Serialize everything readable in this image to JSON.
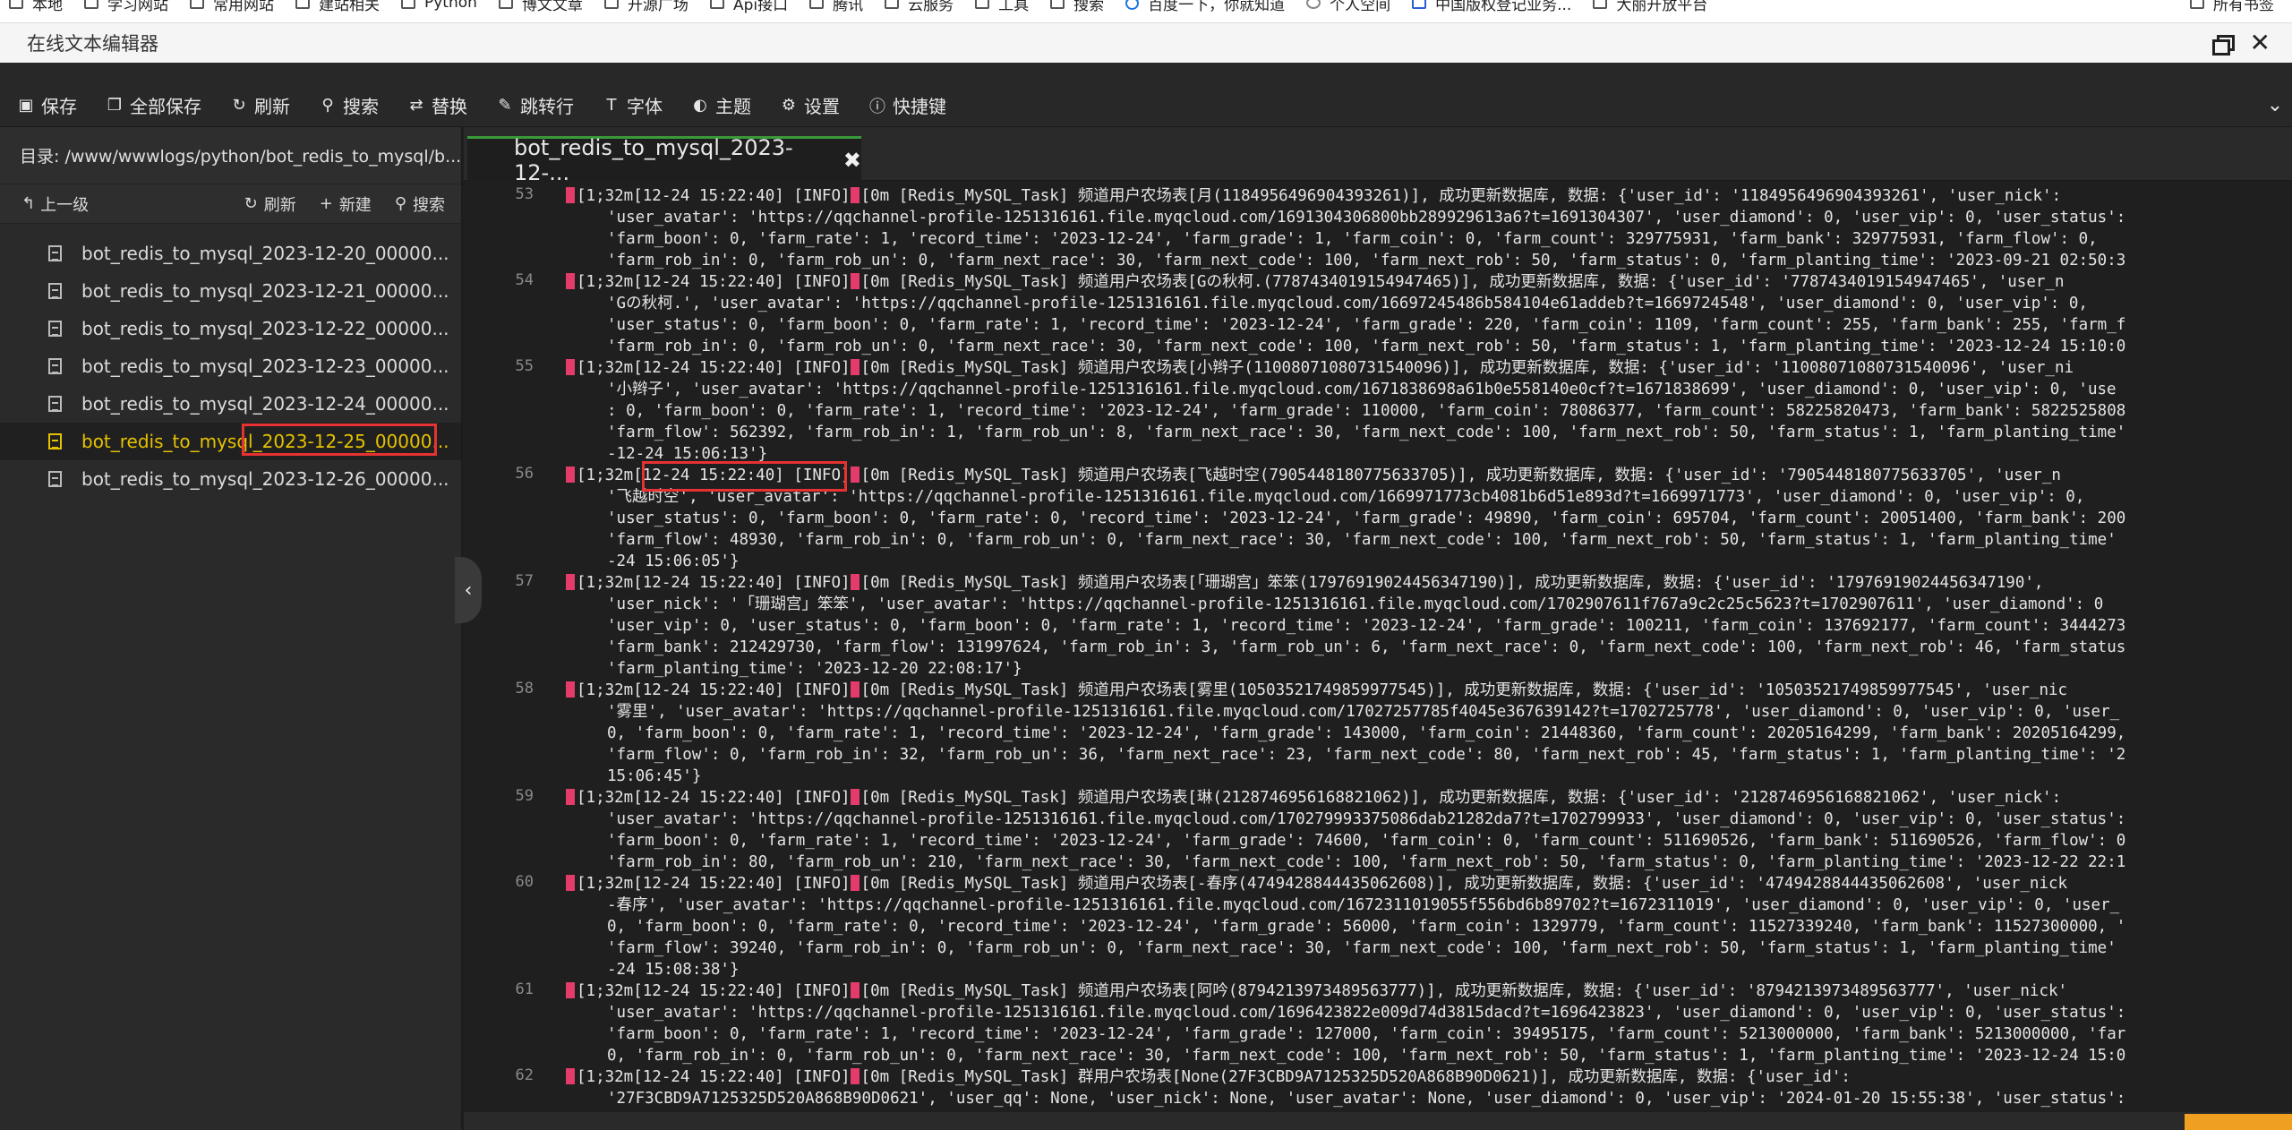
{
  "bookmarks": [
    "本地",
    "学习网站",
    "常用网站",
    "建站相关",
    "Python",
    "博文文章",
    "开源广场",
    "Api接口",
    "腾讯",
    "云服务",
    "工具",
    "搜索",
    "百度一下，你就知道",
    "个人空间",
    "中国版权登记业务...",
    "大丽开放平台"
  ],
  "bookmarks_right": "所有书签",
  "window": {
    "title": "在线文本编辑器"
  },
  "toolbar": {
    "save": "保存",
    "save_all": "全部保存",
    "refresh": "刷新",
    "search": "搜索",
    "replace": "替换",
    "goto_line": "跳转行",
    "font": "字体",
    "theme": "主题",
    "settings": "设置",
    "shortcuts": "快捷键"
  },
  "sidebar": {
    "dir_path": "目录: /www/wwwlogs/python/bot_redis_to_mysql/b...",
    "up_label": "上一级",
    "refresh_label": "刷新",
    "new_label": "新建",
    "search_label": "搜索",
    "files": [
      "bot_redis_to_mysql_2023-12-20_00000...",
      "bot_redis_to_mysql_2023-12-21_00000...",
      "bot_redis_to_mysql_2023-12-22_00000...",
      "bot_redis_to_mysql_2023-12-23_00000...",
      "bot_redis_to_mysql_2023-12-24_00000...",
      "bot_redis_to_mysql_2023-12-25_00000...",
      "bot_redis_to_mysql_2023-12-26_00000..."
    ],
    "active_index": 5
  },
  "editor": {
    "tab_title": "bot_redis_to_mysql_2023-12-...",
    "lines": [
      {
        "n": "53",
        "rows": [
          "[1;32m[12-24 15:22:40] [INFO]|[0m [Redis_MySQL_Task] 频道用户农场表[月(1184956496904393261)], 成功更新数据库, 数据: {'user_id': '1184956496904393261', 'user_nick':",
          "'user_avatar': 'https://qqchannel-profile-1251316161.file.myqcloud.com/1691304306800bb289929613a6?t=1691304307', 'user_diamond': 0, 'user_vip': 0, 'user_status':",
          "'farm_boon': 0, 'farm_rate': 1, 'record_time': '2023-12-24', 'farm_grade': 1, 'farm_coin': 0, 'farm_count': 329775931, 'farm_bank': 329775931, 'farm_flow': 0,",
          "'farm_rob_in': 0, 'farm_rob_un': 0, 'farm_next_race': 30, 'farm_next_code': 100, 'farm_next_rob': 50, 'farm_status': 0, 'farm_planting_time': '2023-09-21 02:50:3"
        ]
      },
      {
        "n": "54",
        "rows": [
          "[1;32m[12-24 15:22:40] [INFO]|[0m [Redis_MySQL_Task] 频道用户农场表[Gの秋柯.(7787434019154947465)], 成功更新数据库, 数据: {'user_id': '7787434019154947465', 'user_n",
          "'Gの秋柯.', 'user_avatar': 'https://qqchannel-profile-1251316161.file.myqcloud.com/16697245486b584104e61addeb?t=1669724548', 'user_diamond': 0, 'user_vip': 0,",
          "'user_status': 0, 'farm_boon': 0, 'farm_rate': 1, 'record_time': '2023-12-24', 'farm_grade': 220, 'farm_coin': 1109, 'farm_count': 255, 'farm_bank': 255, 'farm_f",
          "'farm_rob_in': 0, 'farm_rob_un': 0, 'farm_next_race': 30, 'farm_next_code': 100, 'farm_next_rob': 50, 'farm_status': 1, 'farm_planting_time': '2023-12-24 15:10:0"
        ]
      },
      {
        "n": "55",
        "rows": [
          "[1;32m[12-24 15:22:40] [INFO]|[0m [Redis_MySQL_Task] 频道用户农场表[小辫子(11008071080731540096)], 成功更新数据库, 数据: {'user_id': '11008071080731540096', 'user_ni",
          "'小辫子', 'user_avatar': 'https://qqchannel-profile-1251316161.file.myqcloud.com/1671838698a61b0e558140e0cf?t=1671838699', 'user_diamond': 0, 'user_vip': 0, 'use",
          ": 0, 'farm_boon': 0, 'farm_rate': 1, 'record_time': '2023-12-24', 'farm_grade': 110000, 'farm_coin': 78086377, 'farm_count': 58225820473, 'farm_bank': 5822525808",
          "'farm_flow': 562392, 'farm_rob_in': 1, 'farm_rob_un': 8, 'farm_next_race': 30, 'farm_next_code': 100, 'farm_next_rob': 50, 'farm_status': 1, 'farm_planting_time'",
          "-12-24 15:06:13'}"
        ]
      },
      {
        "n": "56",
        "rows": [
          "[1;32m[12-24 15:22:40] [INFO]|[0m [Redis_MySQL_Task] 频道用户农场表[飞越时空(7905448180775633705)], 成功更新数据库, 数据: {'user_id': '7905448180775633705', 'user_n",
          "'飞越时空', 'user_avatar': 'https://qqchannel-profile-1251316161.file.myqcloud.com/1669971773cb4081b6d51e893d?t=1669971773', 'user_diamond': 0, 'user_vip': 0,",
          "'user_status': 0, 'farm_boon': 0, 'farm_rate': 0, 'record_time': '2023-12-24', 'farm_grade': 49890, 'farm_coin': 695704, 'farm_count': 20051400, 'farm_bank': 200",
          "'farm_flow': 48930, 'farm_rob_in': 0, 'farm_rob_un': 0, 'farm_next_race': 30, 'farm_next_code': 100, 'farm_next_rob': 50, 'farm_status': 1, 'farm_planting_time'",
          "-24 15:06:05'}"
        ]
      },
      {
        "n": "57",
        "rows": [
          "[1;32m[12-24 15:22:40] [INFO]|[0m [Redis_MySQL_Task] 频道用户农场表[「珊瑚宫」笨笨(17976919024456347190)], 成功更新数据库, 数据: {'user_id': '17976919024456347190',",
          "'user_nick': '「珊瑚宫」笨笨', 'user_avatar': 'https://qqchannel-profile-1251316161.file.myqcloud.com/1702907611f767a9c2c25c5623?t=1702907611', 'user_diamond': 0",
          "'user_vip': 0, 'user_status': 0, 'farm_boon': 0, 'farm_rate': 1, 'record_time': '2023-12-24', 'farm_grade': 100211, 'farm_coin': 137692177, 'farm_count': 3444273",
          "'farm_bank': 212429730, 'farm_flow': 131997624, 'farm_rob_in': 3, 'farm_rob_un': 6, 'farm_next_race': 0, 'farm_next_code': 100, 'farm_next_rob': 46, 'farm_status",
          "'farm_planting_time': '2023-12-20 22:08:17'}"
        ]
      },
      {
        "n": "58",
        "rows": [
          "[1;32m[12-24 15:22:40] [INFO]|[0m [Redis_MySQL_Task] 频道用户农场表[雾里(10503521749859977545)], 成功更新数据库, 数据: {'user_id': '10503521749859977545', 'user_nic",
          "'雾里', 'user_avatar': 'https://qqchannel-profile-1251316161.file.myqcloud.com/17027257785f4045e367639142?t=1702725778', 'user_diamond': 0, 'user_vip': 0, 'user_",
          "0, 'farm_boon': 0, 'farm_rate': 1, 'record_time': '2023-12-24', 'farm_grade': 143000, 'farm_coin': 21448360, 'farm_count': 20205164299, 'farm_bank': 20205164299,",
          "'farm_flow': 0, 'farm_rob_in': 32, 'farm_rob_un': 36, 'farm_next_race': 23, 'farm_next_code': 80, 'farm_next_rob': 45, 'farm_status': 1, 'farm_planting_time': '2",
          "15:06:45'}"
        ]
      },
      {
        "n": "59",
        "rows": [
          "[1;32m[12-24 15:22:40] [INFO]|[0m [Redis_MySQL_Task] 频道用户农场表[琳(2128746956168821062)], 成功更新数据库, 数据: {'user_id': '2128746956168821062', 'user_nick':",
          "'user_avatar': 'https://qqchannel-profile-1251316161.file.myqcloud.com/170279993375086dab21282da7?t=1702799933', 'user_diamond': 0, 'user_vip': 0, 'user_status':",
          "'farm_boon': 0, 'farm_rate': 1, 'record_time': '2023-12-24', 'farm_grade': 74600, 'farm_coin': 0, 'farm_count': 511690526, 'farm_bank': 511690526, 'farm_flow': 0",
          "'farm_rob_in': 80, 'farm_rob_un': 210, 'farm_next_race': 30, 'farm_next_code': 100, 'farm_next_rob': 50, 'farm_status': 0, 'farm_planting_time': '2023-12-22 22:1"
        ]
      },
      {
        "n": "60",
        "rows": [
          "[1;32m[12-24 15:22:40] [INFO]|[0m [Redis_MySQL_Task] 频道用户农场表[-春序(4749428844435062608)], 成功更新数据库, 数据: {'user_id': '4749428844435062608', 'user_nick",
          "-春序', 'user_avatar': 'https://qqchannel-profile-1251316161.file.myqcloud.com/1672311019055f556bd6b89702?t=1672311019', 'user_diamond': 0, 'user_vip': 0, 'user_",
          "0, 'farm_boon': 0, 'farm_rate': 0, 'record_time': '2023-12-24', 'farm_grade': 56000, 'farm_coin': 1329779, 'farm_count': 11527339240, 'farm_bank': 11527300000, '",
          "'farm_flow': 39240, 'farm_rob_in': 0, 'farm_rob_un': 0, 'farm_next_race': 30, 'farm_next_code': 100, 'farm_next_rob': 50, 'farm_status': 1, 'farm_planting_time'",
          "-24 15:08:38'}"
        ]
      },
      {
        "n": "61",
        "rows": [
          "[1;32m[12-24 15:22:40] [INFO]|[0m [Redis_MySQL_Task] 频道用户农场表[阿吟(8794213973489563777)], 成功更新数据库, 数据: {'user_id': '8794213973489563777', 'user_nick'",
          "'user_avatar': 'https://qqchannel-profile-1251316161.file.myqcloud.com/1696423822e009d74d3815dacd?t=1696423823', 'user_diamond': 0, 'user_vip': 0, 'user_status':",
          "'farm_boon': 0, 'farm_rate': 1, 'record_time': '2023-12-24', 'farm_grade': 127000, 'farm_coin': 39495175, 'farm_count': 5213000000, 'farm_bank': 5213000000, 'far",
          "0, 'farm_rob_in': 0, 'farm_rob_un': 0, 'farm_next_race': 30, 'farm_next_code': 100, 'farm_next_rob': 50, 'farm_status': 1, 'farm_planting_time': '2023-12-24 15:0"
        ]
      },
      {
        "n": "62",
        "rows": [
          "[1;32m[12-24 15:22:40] [INFO]|[0m [Redis_MySQL_Task] 群用户农场表[None(27F3CBD9A7125325D520A868B90D0621)], 成功更新数据库, 数据: {'user_id':",
          "'27F3CBD9A7125325D520A868B90D0621', 'user_qq': None, 'user_nick': None, 'user_avatar': None, 'user_diamond': 0, 'user_vip': '2024-01-20 15:55:38', 'user_status':"
        ]
      }
    ]
  },
  "colors": {
    "active_file": "#e6c200",
    "highlight_box": "#e63232",
    "escape_marker": "#e33b6a",
    "tab_accent": "#3a9a3a"
  }
}
